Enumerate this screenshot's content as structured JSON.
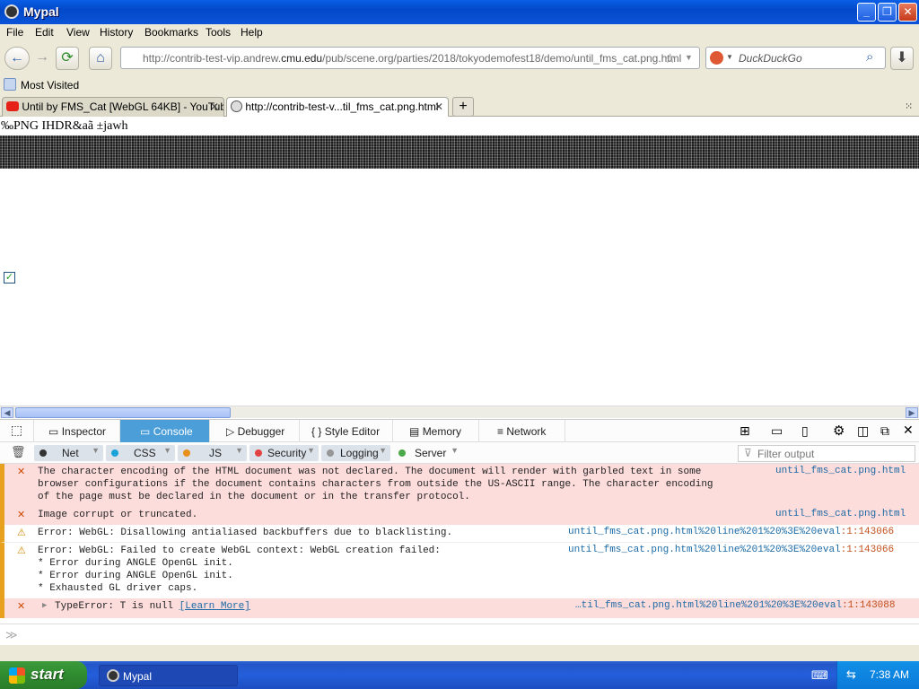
{
  "window": {
    "title": "Mypal"
  },
  "menu": [
    "File",
    "Edit",
    "View",
    "History",
    "Bookmarks",
    "Tools",
    "Help"
  ],
  "nav": {
    "url_prefix": "http://contrib-test-vip.andrew.",
    "url_domain": "cmu.edu",
    "url_suffix": "/pub/scene.org/parties/2018/tokyodemofest18/demo/until_fms_cat.png.html",
    "search_placeholder": "DuckDuckGo"
  },
  "bookmarks": {
    "most_visited": "Most Visited"
  },
  "tabs": [
    {
      "label": "Until by FMS_Cat [WebGL 64KB] - YouTube",
      "active": false
    },
    {
      "label": "http://contrib-test-v...til_fms_cat.png.html",
      "active": true
    }
  ],
  "page": {
    "png_text": "‰PNG  IHDR&aã ±jawh"
  },
  "devtools": {
    "tabs": [
      "Inspector",
      "Console",
      "Debugger",
      "Style Editor",
      "Memory",
      "Network"
    ],
    "active_tab": "Console",
    "filters": [
      {
        "label": "Net",
        "color": "#333333"
      },
      {
        "label": "CSS",
        "color": "#1aa3d8"
      },
      {
        "label": "JS",
        "color": "#e9901c"
      },
      {
        "label": "Security",
        "color": "#e34242"
      },
      {
        "label": "Logging",
        "color": "#969696"
      },
      {
        "label": "Server",
        "color": "#4aa84a"
      }
    ],
    "filter_placeholder": "Filter output",
    "messages": [
      {
        "type": "error",
        "text": "The character encoding of the HTML document was not declared. The document will render with garbled text in some\nbrowser configurations if the document contains characters from outside the US-ASCII range. The character encoding\nof the page must be declared in the document or in the transfer protocol.",
        "source": "until_fms_cat.png.html",
        "line": ""
      },
      {
        "type": "error",
        "text": "Image corrupt or truncated.",
        "source": "until_fms_cat.png.html",
        "line": ""
      },
      {
        "type": "warning",
        "text": "Error: WebGL: Disallowing antialiased backbuffers due to blacklisting.",
        "source": "until_fms_cat.png.html%20line%201%20%3E%20eval",
        "line": ":1:143066"
      },
      {
        "type": "warning",
        "text": "Error: WebGL: Failed to create WebGL context: WebGL creation failed:\n* Error during ANGLE OpenGL init.\n* Error during ANGLE OpenGL init.\n* Exhausted GL driver caps.",
        "source": "until_fms_cat.png.html%20line%201%20%3E%20eval",
        "line": ":1:143066"
      },
      {
        "type": "error",
        "text": "TypeError: T is null",
        "link": "[Learn More]",
        "source": "…til_fms_cat.png.html%20line%201%20%3E%20eval",
        "line": ":1:143088"
      }
    ]
  },
  "taskbar": {
    "start": "start",
    "task": "Mypal",
    "clock": "7:38 AM"
  }
}
